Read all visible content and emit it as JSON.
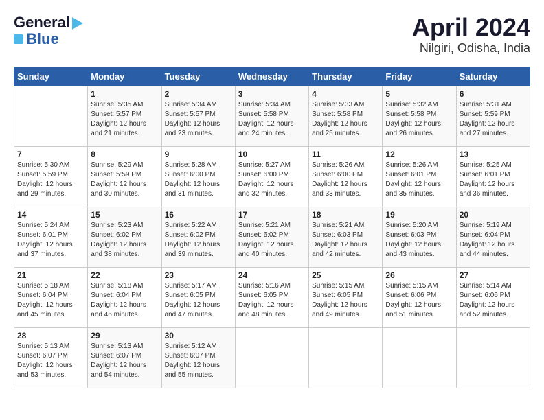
{
  "header": {
    "logo_line1": "General",
    "logo_line2": "Blue",
    "month": "April 2024",
    "location": "Nilgiri, Odisha, India"
  },
  "weekdays": [
    "Sunday",
    "Monday",
    "Tuesday",
    "Wednesday",
    "Thursday",
    "Friday",
    "Saturday"
  ],
  "weeks": [
    [
      {
        "day": "",
        "sunrise": "",
        "sunset": "",
        "daylight": ""
      },
      {
        "day": "1",
        "sunrise": "Sunrise: 5:35 AM",
        "sunset": "Sunset: 5:57 PM",
        "daylight": "Daylight: 12 hours and 21 minutes."
      },
      {
        "day": "2",
        "sunrise": "Sunrise: 5:34 AM",
        "sunset": "Sunset: 5:57 PM",
        "daylight": "Daylight: 12 hours and 23 minutes."
      },
      {
        "day": "3",
        "sunrise": "Sunrise: 5:34 AM",
        "sunset": "Sunset: 5:58 PM",
        "daylight": "Daylight: 12 hours and 24 minutes."
      },
      {
        "day": "4",
        "sunrise": "Sunrise: 5:33 AM",
        "sunset": "Sunset: 5:58 PM",
        "daylight": "Daylight: 12 hours and 25 minutes."
      },
      {
        "day": "5",
        "sunrise": "Sunrise: 5:32 AM",
        "sunset": "Sunset: 5:58 PM",
        "daylight": "Daylight: 12 hours and 26 minutes."
      },
      {
        "day": "6",
        "sunrise": "Sunrise: 5:31 AM",
        "sunset": "Sunset: 5:59 PM",
        "daylight": "Daylight: 12 hours and 27 minutes."
      }
    ],
    [
      {
        "day": "7",
        "sunrise": "Sunrise: 5:30 AM",
        "sunset": "Sunset: 5:59 PM",
        "daylight": "Daylight: 12 hours and 29 minutes."
      },
      {
        "day": "8",
        "sunrise": "Sunrise: 5:29 AM",
        "sunset": "Sunset: 5:59 PM",
        "daylight": "Daylight: 12 hours and 30 minutes."
      },
      {
        "day": "9",
        "sunrise": "Sunrise: 5:28 AM",
        "sunset": "Sunset: 6:00 PM",
        "daylight": "Daylight: 12 hours and 31 minutes."
      },
      {
        "day": "10",
        "sunrise": "Sunrise: 5:27 AM",
        "sunset": "Sunset: 6:00 PM",
        "daylight": "Daylight: 12 hours and 32 minutes."
      },
      {
        "day": "11",
        "sunrise": "Sunrise: 5:26 AM",
        "sunset": "Sunset: 6:00 PM",
        "daylight": "Daylight: 12 hours and 33 minutes."
      },
      {
        "day": "12",
        "sunrise": "Sunrise: 5:26 AM",
        "sunset": "Sunset: 6:01 PM",
        "daylight": "Daylight: 12 hours and 35 minutes."
      },
      {
        "day": "13",
        "sunrise": "Sunrise: 5:25 AM",
        "sunset": "Sunset: 6:01 PM",
        "daylight": "Daylight: 12 hours and 36 minutes."
      }
    ],
    [
      {
        "day": "14",
        "sunrise": "Sunrise: 5:24 AM",
        "sunset": "Sunset: 6:01 PM",
        "daylight": "Daylight: 12 hours and 37 minutes."
      },
      {
        "day": "15",
        "sunrise": "Sunrise: 5:23 AM",
        "sunset": "Sunset: 6:02 PM",
        "daylight": "Daylight: 12 hours and 38 minutes."
      },
      {
        "day": "16",
        "sunrise": "Sunrise: 5:22 AM",
        "sunset": "Sunset: 6:02 PM",
        "daylight": "Daylight: 12 hours and 39 minutes."
      },
      {
        "day": "17",
        "sunrise": "Sunrise: 5:21 AM",
        "sunset": "Sunset: 6:02 PM",
        "daylight": "Daylight: 12 hours and 40 minutes."
      },
      {
        "day": "18",
        "sunrise": "Sunrise: 5:21 AM",
        "sunset": "Sunset: 6:03 PM",
        "daylight": "Daylight: 12 hours and 42 minutes."
      },
      {
        "day": "19",
        "sunrise": "Sunrise: 5:20 AM",
        "sunset": "Sunset: 6:03 PM",
        "daylight": "Daylight: 12 hours and 43 minutes."
      },
      {
        "day": "20",
        "sunrise": "Sunrise: 5:19 AM",
        "sunset": "Sunset: 6:04 PM",
        "daylight": "Daylight: 12 hours and 44 minutes."
      }
    ],
    [
      {
        "day": "21",
        "sunrise": "Sunrise: 5:18 AM",
        "sunset": "Sunset: 6:04 PM",
        "daylight": "Daylight: 12 hours and 45 minutes."
      },
      {
        "day": "22",
        "sunrise": "Sunrise: 5:18 AM",
        "sunset": "Sunset: 6:04 PM",
        "daylight": "Daylight: 12 hours and 46 minutes."
      },
      {
        "day": "23",
        "sunrise": "Sunrise: 5:17 AM",
        "sunset": "Sunset: 6:05 PM",
        "daylight": "Daylight: 12 hours and 47 minutes."
      },
      {
        "day": "24",
        "sunrise": "Sunrise: 5:16 AM",
        "sunset": "Sunset: 6:05 PM",
        "daylight": "Daylight: 12 hours and 48 minutes."
      },
      {
        "day": "25",
        "sunrise": "Sunrise: 5:15 AM",
        "sunset": "Sunset: 6:05 PM",
        "daylight": "Daylight: 12 hours and 49 minutes."
      },
      {
        "day": "26",
        "sunrise": "Sunrise: 5:15 AM",
        "sunset": "Sunset: 6:06 PM",
        "daylight": "Daylight: 12 hours and 51 minutes."
      },
      {
        "day": "27",
        "sunrise": "Sunrise: 5:14 AM",
        "sunset": "Sunset: 6:06 PM",
        "daylight": "Daylight: 12 hours and 52 minutes."
      }
    ],
    [
      {
        "day": "28",
        "sunrise": "Sunrise: 5:13 AM",
        "sunset": "Sunset: 6:07 PM",
        "daylight": "Daylight: 12 hours and 53 minutes."
      },
      {
        "day": "29",
        "sunrise": "Sunrise: 5:13 AM",
        "sunset": "Sunset: 6:07 PM",
        "daylight": "Daylight: 12 hours and 54 minutes."
      },
      {
        "day": "30",
        "sunrise": "Sunrise: 5:12 AM",
        "sunset": "Sunset: 6:07 PM",
        "daylight": "Daylight: 12 hours and 55 minutes."
      },
      {
        "day": "",
        "sunrise": "",
        "sunset": "",
        "daylight": ""
      },
      {
        "day": "",
        "sunrise": "",
        "sunset": "",
        "daylight": ""
      },
      {
        "day": "",
        "sunrise": "",
        "sunset": "",
        "daylight": ""
      },
      {
        "day": "",
        "sunrise": "",
        "sunset": "",
        "daylight": ""
      }
    ]
  ]
}
